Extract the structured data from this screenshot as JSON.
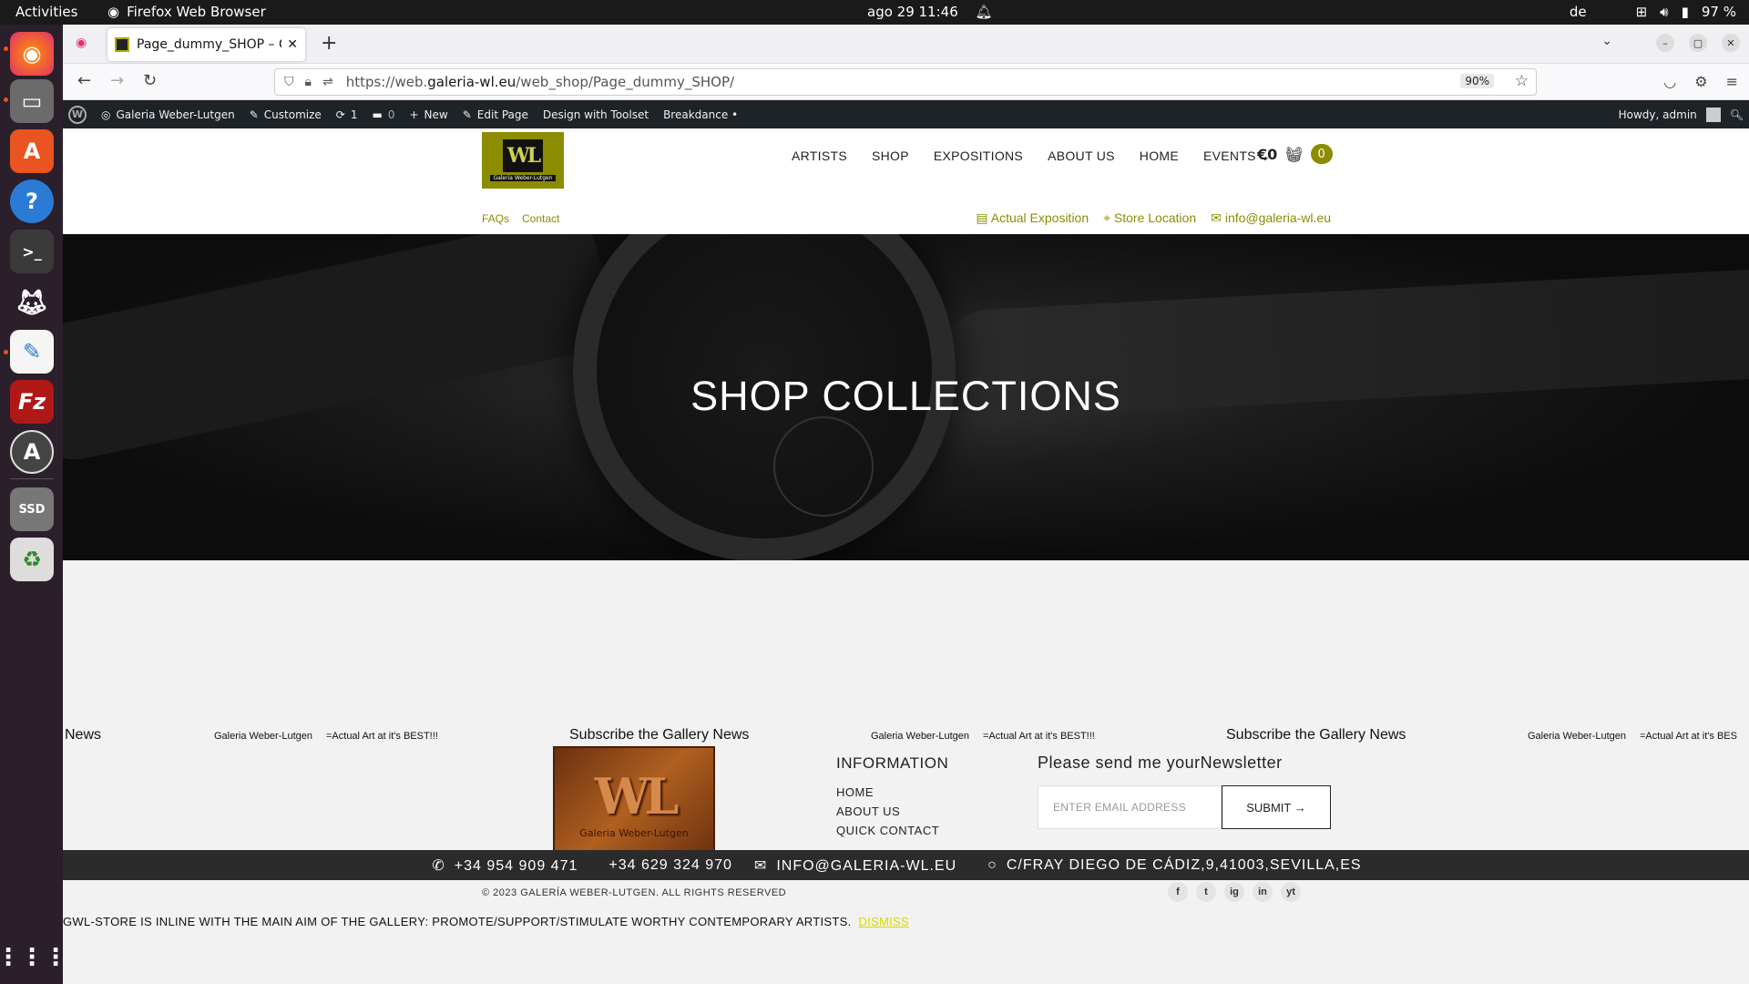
{
  "os": {
    "activities": "Activities",
    "app_name": "Firefox Web Browser",
    "clock": "ago 29  11:46",
    "lang": "de",
    "battery": "97 %"
  },
  "browser": {
    "tab_title": "Page_dummy_SHOP – Ga",
    "url_prefix": "https://web.",
    "url_host": "galeria-wl.eu",
    "url_path": "/web_shop/Page_dummy_SHOP/",
    "zoom": "90%"
  },
  "wpbar": {
    "site_name": "Galeria Weber-Lutgen",
    "customize": "Customize",
    "updates": "1",
    "comments": "0",
    "new": "New",
    "edit_page": "Edit Page",
    "design_toolset": "Design with Toolset",
    "breakdance": "Breakdance •",
    "howdy": "Howdy, admin"
  },
  "header": {
    "logo_mark": "WL",
    "logo_name": "Galeria Weber-Lutgen",
    "menu": [
      "ARTISTS",
      "SHOP",
      "EXPOSITIONS",
      "ABOUT US",
      "HOME",
      "EVENTS"
    ],
    "cart_total": "€0",
    "cart_count": "0",
    "sub_left": [
      "FAQs",
      "Contact"
    ],
    "sub_right": [
      "Actual Exposition",
      "Store Location",
      "info@galeria-wl.eu"
    ]
  },
  "hero": {
    "title": "SHOP COLLECTIONS"
  },
  "ticker": {
    "news_fragment": "News",
    "tagline_name": "Galeria Weber-Lutgen",
    "tagline_text": "=Actual Art at it's BEST!!!",
    "subscribe": "Subscribe the Gallery News",
    "tagline_text_cut": "=Actual Art at it's BES"
  },
  "footer": {
    "logo_mark": "WL",
    "logo_name": "Galeria Weber-Lutgen",
    "info_title": "INFORMATION",
    "info_links": [
      "HOME",
      "ABOUT US",
      "QUICK CONTACT"
    ],
    "newsletter_title": "Please send me yourNewsletter",
    "email_placeholder": "ENTER EMAIL ADDRESS",
    "submit": "SUBMIT →",
    "phone1": "+34 954 909 471",
    "phone2": "+34 629 324 970",
    "email": "INFO@GALERIA-WL.EU",
    "address": "C/FRAY DIEGO DE CÁDIZ,9,41003,SEVILLA,ES",
    "copyright": "© 2023 GALERÍA WEBER-LUTGEN. ALL RIGHTS RESERVED",
    "social": [
      "f",
      "t",
      "ig",
      "in",
      "yt"
    ],
    "notice": "GWL-STORE IS INLINE WITH THE MAIN AIM OF THE GALLERY: PROMOTE/SUPPORT/STIMULATE WORTHY CONTEMPORARY ARTISTS.",
    "dismiss": "DISMISS"
  },
  "colors": {
    "accent": "#8c8c00",
    "dark_bar": "#2b2b2b",
    "dismiss": "#d8d800"
  }
}
